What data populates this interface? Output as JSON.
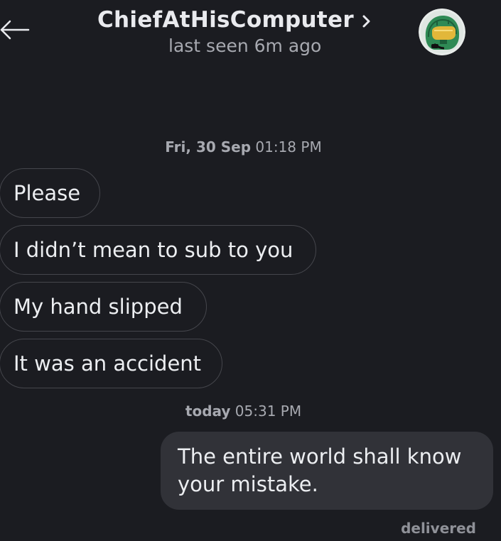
{
  "header": {
    "back_icon": "arrow-left-icon",
    "title": "ChiefAtHisComputer",
    "title_chevron_icon": "chevron-right-icon",
    "subtitle": "last seen 6m ago",
    "avatar_icon": "master-chief-helmet-avatar"
  },
  "conversation": {
    "groups": [
      {
        "day": "Fri, 30 Sep",
        "time": "01:18 PM",
        "messages": [
          {
            "direction": "incoming",
            "text": "Please"
          },
          {
            "direction": "incoming",
            "text": "I didn’t mean to sub to you"
          },
          {
            "direction": "incoming",
            "text": "My hand slipped"
          },
          {
            "direction": "incoming",
            "text": "It was an accident"
          }
        ]
      },
      {
        "day": "today",
        "time": "05:31 PM",
        "messages": [
          {
            "direction": "outgoing",
            "text": "The entire world shall know your mistake."
          }
        ]
      }
    ],
    "status": "delivered"
  },
  "colors": {
    "background": "#1b1c21",
    "outgoing_bubble": "#313238",
    "incoming_border": "#45464c",
    "text_primary": "#eceef1",
    "text_secondary": "#a7a9b0",
    "avatar_green": "#2f8a55"
  }
}
